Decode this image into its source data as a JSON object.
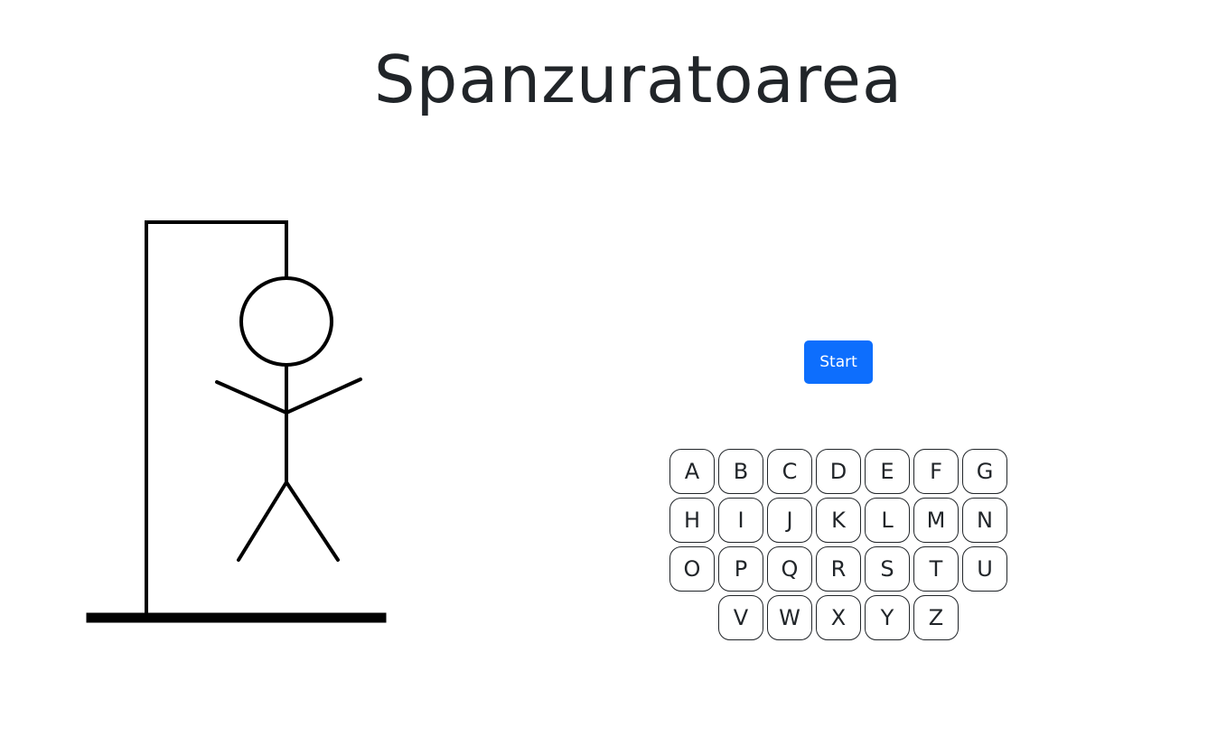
{
  "title": "Spanzuratoarea",
  "start_label": "Start",
  "keyboard": {
    "rows": [
      [
        "A",
        "B",
        "C",
        "D",
        "E",
        "F",
        "G"
      ],
      [
        "H",
        "I",
        "J",
        "K",
        "L",
        "M",
        "N"
      ],
      [
        "O",
        "P",
        "Q",
        "R",
        "S",
        "T",
        "U"
      ],
      [
        "V",
        "W",
        "X",
        "Y",
        "Z"
      ]
    ]
  },
  "colors": {
    "accent": "#0d6efd",
    "text": "#212529",
    "drawing": "#000000"
  },
  "icons": [
    "gallows-icon",
    "hangman-figure-icon"
  ]
}
